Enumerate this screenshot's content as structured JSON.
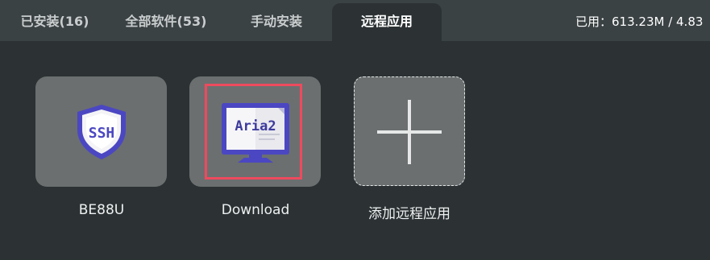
{
  "tabs": [
    {
      "label": "已安装(16)",
      "active": false
    },
    {
      "label": "全部软件(53)",
      "active": false
    },
    {
      "label": "手动安装",
      "active": false
    },
    {
      "label": "远程应用",
      "active": true
    }
  ],
  "usage": {
    "text": "已用：613.23M / 4.83"
  },
  "apps": [
    {
      "label": "BE88U",
      "icon": "ssh-shield-icon",
      "icon_text": "SSH"
    },
    {
      "label": "Download",
      "icon": "aria2-monitor-icon",
      "icon_text": "Aria2"
    }
  ],
  "add_app": {
    "label": "添加远程应用",
    "icon": "plus-icon"
  },
  "colors": {
    "background": "#2c3234",
    "tabbar": "#3b4244",
    "tile": "#6b6f70",
    "icon_accent": "#4b47c2",
    "highlight": "#ee4a5e"
  }
}
